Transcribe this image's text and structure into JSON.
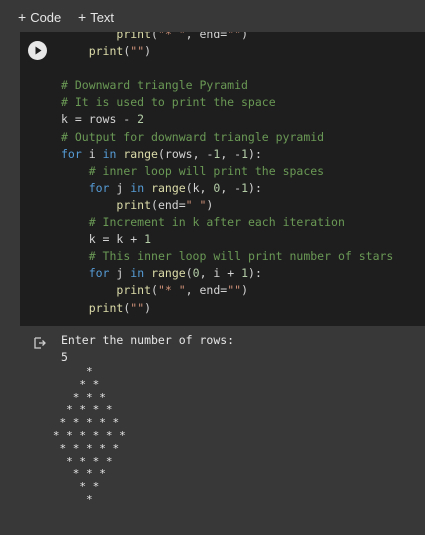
{
  "toolbar": {
    "code_button": "Code",
    "text_button": "Text"
  },
  "cell": {
    "lines": [
      [
        {
          "t": "        "
        },
        {
          "t": "print",
          "c": "fn"
        },
        {
          "t": "(",
          "c": "var"
        },
        {
          "t": "\"* \"",
          "c": "str"
        },
        {
          "t": ", end=",
          "c": "var"
        },
        {
          "t": "\"\"",
          "c": "str"
        },
        {
          "t": ")",
          "c": "var"
        }
      ],
      [
        {
          "t": "    "
        },
        {
          "t": "print",
          "c": "fn"
        },
        {
          "t": "(",
          "c": "var"
        },
        {
          "t": "\"\"",
          "c": "str"
        },
        {
          "t": ")",
          "c": "var"
        }
      ],
      [
        {
          "t": ""
        }
      ],
      [
        {
          "t": "# Downward triangle Pyramid",
          "c": "cm"
        }
      ],
      [
        {
          "t": "# It is used to print the space",
          "c": "cm"
        }
      ],
      [
        {
          "t": "k = rows - ",
          "c": "var"
        },
        {
          "t": "2",
          "c": "num"
        }
      ],
      [
        {
          "t": "# Output for downward triangle pyramid",
          "c": "cm"
        }
      ],
      [
        {
          "t": "for",
          "c": "kw"
        },
        {
          "t": " i ",
          "c": "var"
        },
        {
          "t": "in",
          "c": "kw"
        },
        {
          "t": " ",
          "c": "var"
        },
        {
          "t": "range",
          "c": "fn"
        },
        {
          "t": "(rows, -",
          "c": "var"
        },
        {
          "t": "1",
          "c": "num"
        },
        {
          "t": ", -",
          "c": "var"
        },
        {
          "t": "1",
          "c": "num"
        },
        {
          "t": "):",
          "c": "var"
        }
      ],
      [
        {
          "t": "    "
        },
        {
          "t": "# inner loop will print the spaces",
          "c": "cm"
        }
      ],
      [
        {
          "t": "    "
        },
        {
          "t": "for",
          "c": "kw"
        },
        {
          "t": " j ",
          "c": "var"
        },
        {
          "t": "in",
          "c": "kw"
        },
        {
          "t": " ",
          "c": "var"
        },
        {
          "t": "range",
          "c": "fn"
        },
        {
          "t": "(k, ",
          "c": "var"
        },
        {
          "t": "0",
          "c": "num"
        },
        {
          "t": ", -",
          "c": "var"
        },
        {
          "t": "1",
          "c": "num"
        },
        {
          "t": "):",
          "c": "var"
        }
      ],
      [
        {
          "t": "        "
        },
        {
          "t": "print",
          "c": "fn"
        },
        {
          "t": "(end=",
          "c": "var"
        },
        {
          "t": "\" \"",
          "c": "str"
        },
        {
          "t": ")",
          "c": "var"
        }
      ],
      [
        {
          "t": "    "
        },
        {
          "t": "# Increment in k after each iteration",
          "c": "cm"
        }
      ],
      [
        {
          "t": "    k = k + ",
          "c": "var"
        },
        {
          "t": "1",
          "c": "num"
        }
      ],
      [
        {
          "t": "    "
        },
        {
          "t": "# This inner loop will print number of stars",
          "c": "cm"
        }
      ],
      [
        {
          "t": "    "
        },
        {
          "t": "for",
          "c": "kw"
        },
        {
          "t": " j ",
          "c": "var"
        },
        {
          "t": "in",
          "c": "kw"
        },
        {
          "t": " ",
          "c": "var"
        },
        {
          "t": "range",
          "c": "fn"
        },
        {
          "t": "(",
          "c": "var"
        },
        {
          "t": "0",
          "c": "num"
        },
        {
          "t": ", i + ",
          "c": "var"
        },
        {
          "t": "1",
          "c": "num"
        },
        {
          "t": "):",
          "c": "var"
        }
      ],
      [
        {
          "t": "        "
        },
        {
          "t": "print",
          "c": "fn"
        },
        {
          "t": "(",
          "c": "var"
        },
        {
          "t": "\"* \"",
          "c": "str"
        },
        {
          "t": ", end=",
          "c": "var"
        },
        {
          "t": "\"\"",
          "c": "str"
        },
        {
          "t": ")",
          "c": "var"
        }
      ],
      [
        {
          "t": "    "
        },
        {
          "t": "print",
          "c": "fn"
        },
        {
          "t": "(",
          "c": "var"
        },
        {
          "t": "\"\"",
          "c": "str"
        },
        {
          "t": ")",
          "c": "var"
        }
      ]
    ]
  },
  "output": {
    "prompt": "Enter the number of rows:",
    "input_value": "5",
    "pyramid": [
      "        *",
      "       * *",
      "      * * *",
      "     * * * *",
      "    * * * * *",
      "   * * * * * *",
      "    * * * * *",
      "     * * * *",
      "      * * *",
      "       * *",
      "        *"
    ]
  },
  "colors": {
    "background": "#383838",
    "cell_background": "#1e1e1e",
    "keyword": "#569cd6",
    "function": "#dcdcaa",
    "string": "#ce9178",
    "number": "#b5cea8",
    "comment": "#6a9955"
  }
}
